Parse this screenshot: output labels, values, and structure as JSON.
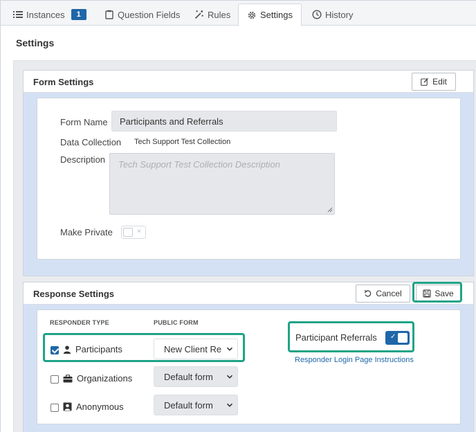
{
  "tabs": [
    {
      "label": "Instances",
      "badge": "1",
      "icon": "list-icon"
    },
    {
      "label": "Question Fields",
      "icon": "clipboard-icon"
    },
    {
      "label": "Rules",
      "icon": "magic-wand-icon"
    },
    {
      "label": "Settings",
      "icon": "gear-icon",
      "active": true
    },
    {
      "label": "History",
      "icon": "clock-icon"
    }
  ],
  "page": {
    "title": "Settings"
  },
  "form_settings": {
    "title": "Form Settings",
    "edit_label": "Edit",
    "form_name_label": "Form Name",
    "form_name_value": "Participants and Referrals",
    "data_collection_label": "Data Collection",
    "data_collection_value": "Tech Support Test Collection",
    "description_label": "Description",
    "description_placeholder": "Tech Support Test Collection Description",
    "make_private_label": "Make Private",
    "make_private_on": false
  },
  "response_settings": {
    "title": "Response Settings",
    "cancel_label": "Cancel",
    "save_label": "Save",
    "col_responder_type": "RESPONDER TYPE",
    "col_public_form": "PUBLIC FORM",
    "rows": [
      {
        "label": "Participants",
        "checked": true,
        "form": "New Client Re",
        "icon": "user-icon"
      },
      {
        "label": "Organizations",
        "checked": false,
        "form": "Default form",
        "icon": "briefcase-icon"
      },
      {
        "label": "Anonymous",
        "checked": false,
        "form": "Default form",
        "icon": "anonymous-user-icon"
      }
    ],
    "participant_referrals_label": "Participant Referrals",
    "participant_referrals_on": true,
    "login_link": "Responder Login Page Instructions"
  },
  "colors": {
    "accent": "#1f67a8",
    "highlight": "#1fa386",
    "panel_bg": "#d4e1f5"
  }
}
